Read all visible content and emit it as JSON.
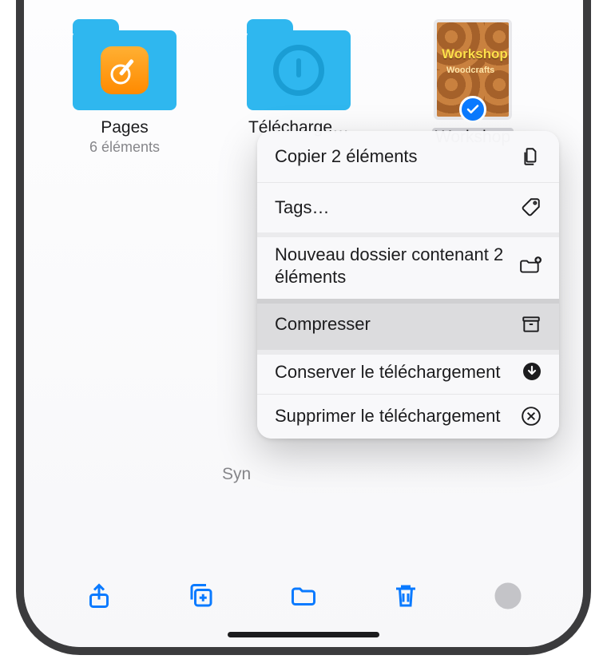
{
  "items": [
    {
      "name": "Pages",
      "subtitle": "6 éléments",
      "kind": "folder-pages"
    },
    {
      "name": "Télécharge…",
      "subtitle": "",
      "kind": "folder-downloads"
    },
    {
      "name": "Workshop",
      "subtitle": "",
      "kind": "file-workshop",
      "selected": true,
      "thumb_title": "Workshop",
      "thumb_sub": "Woodcrafts"
    }
  ],
  "menu": {
    "copy": {
      "label": "Copier 2 éléments"
    },
    "tags": {
      "label": "Tags…"
    },
    "newfolder": {
      "label": "Nouveau dossier contenant 2 éléments"
    },
    "compress": {
      "label": "Compresser"
    },
    "keep_dl": {
      "label": "Conserver le téléchargement"
    },
    "remove_dl": {
      "label": "Supprimer le téléchargement"
    }
  },
  "sync_hint": "Syn",
  "colors": {
    "ios_blue": "#0a7aff",
    "folder_blue": "#2fb7ef"
  }
}
